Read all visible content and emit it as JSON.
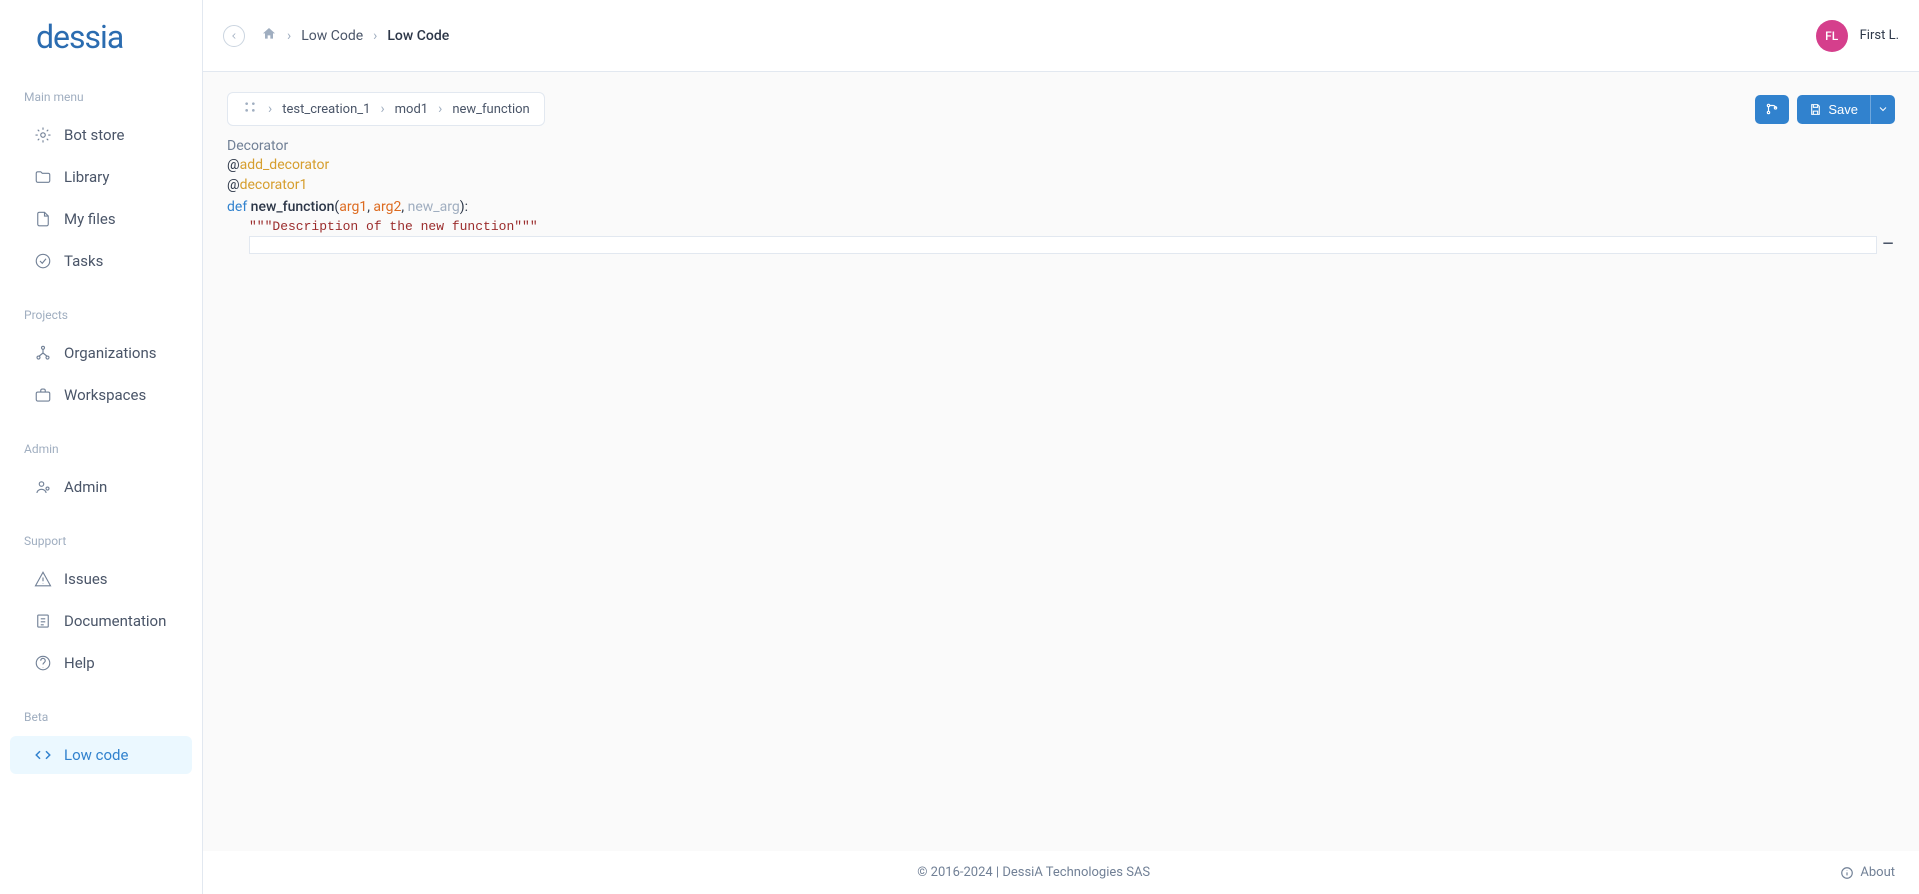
{
  "logo": "dessia",
  "user": {
    "initials": "FL",
    "name": "First L."
  },
  "topBreadcrumb": {
    "item1": "Low Code",
    "item2": "Low Code"
  },
  "sidebar": {
    "sections": {
      "main": {
        "heading": "Main menu",
        "items": {
          "bot": "Bot store",
          "library": "Library",
          "files": "My files",
          "tasks": "Tasks"
        }
      },
      "projects": {
        "heading": "Projects",
        "items": {
          "orgs": "Organizations",
          "workspaces": "Workspaces"
        }
      },
      "admin": {
        "heading": "Admin",
        "items": {
          "admin": "Admin"
        }
      },
      "support": {
        "heading": "Support",
        "items": {
          "issues": "Issues",
          "docs": "Documentation",
          "help": "Help"
        }
      },
      "beta": {
        "heading": "Beta",
        "items": {
          "lowcode": "Low code"
        }
      }
    }
  },
  "contentBreadcrumb": {
    "c1": "test_creation_1",
    "c2": "mod1",
    "c3": "new_function"
  },
  "buttons": {
    "save": "Save"
  },
  "code": {
    "decoratorLabel": "Decorator",
    "at": "@",
    "dec1": "add_decorator",
    "dec2": "decorator1",
    "def": "def",
    "fn": "new_function",
    "open": "(",
    "arg1": "arg1",
    "comma": ", ",
    "arg2": "arg2",
    "arg3": "new_arg",
    "close": "):",
    "docstring": "\"\"\"Description of the new function\"\"\""
  },
  "footer": {
    "copyright": "© 2016-2024 | DessiA Technologies SAS",
    "about": "About"
  }
}
